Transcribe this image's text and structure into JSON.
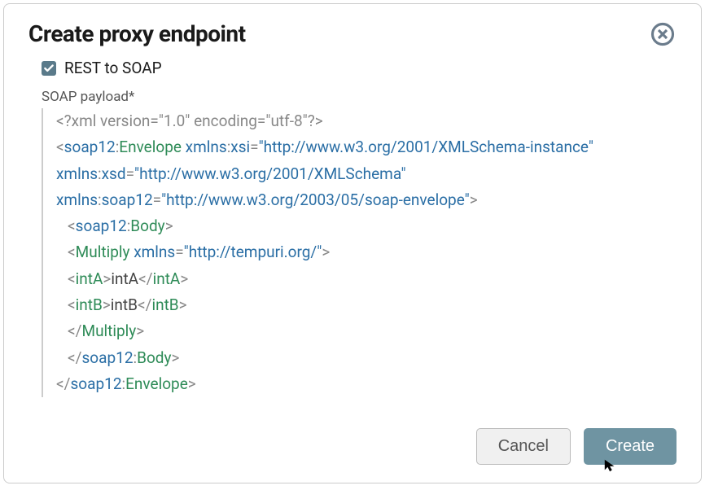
{
  "dialog": {
    "title": "Create proxy endpoint",
    "checkbox_label": "REST to SOAP",
    "checkbox_checked": true,
    "field_label": "SOAP payload*",
    "buttons": {
      "cancel": "Cancel",
      "create": "Create"
    }
  },
  "soap_payload": {
    "xml_declaration": "<?xml version=\"1.0\" encoding=\"utf-8\"?>",
    "envelope_open": {
      "ns": "soap12",
      "tag": "Envelope",
      "attrs": {
        "xmlns:xsi": "http://www.w3.org/2001/XMLSchema-instance",
        "xmlns:xsd": "http://www.w3.org/2001/XMLSchema",
        "xmlns:soap12": "http://www.w3.org/2003/05/soap-envelope"
      }
    },
    "body_open": {
      "ns": "soap12",
      "tag": "Body"
    },
    "multiply_open": {
      "tag": "Multiply",
      "attrs": {
        "xmlns": "http://tempuri.org/"
      }
    },
    "intA": {
      "tag": "intA",
      "text": "intA"
    },
    "intB": {
      "tag": "intB",
      "text": "intB"
    },
    "multiply_close": "Multiply",
    "body_close": {
      "ns": "soap12",
      "tag": "Body"
    },
    "envelope_close": {
      "ns": "soap12",
      "tag": "Envelope"
    }
  }
}
